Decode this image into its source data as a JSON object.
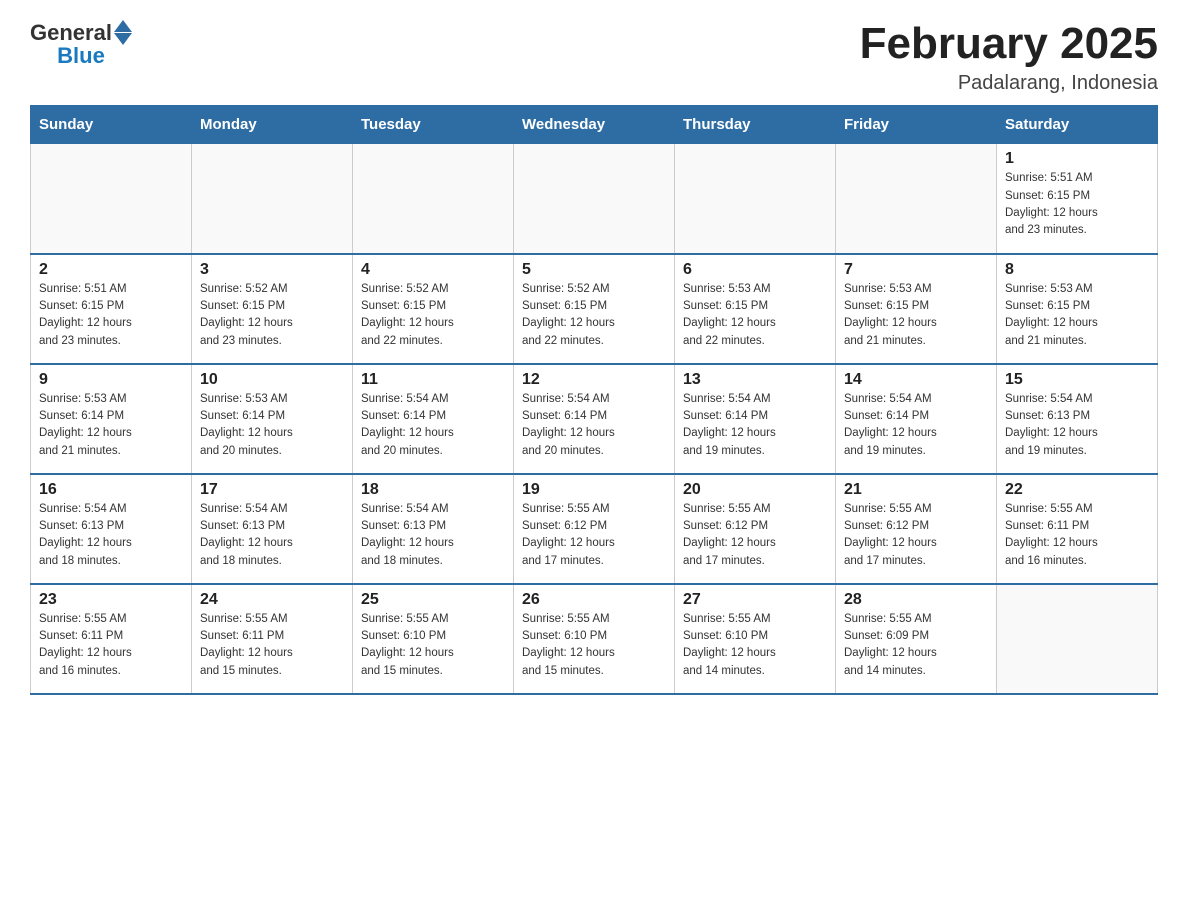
{
  "header": {
    "logo_general": "General",
    "logo_blue": "Blue",
    "title": "February 2025",
    "subtitle": "Padalarang, Indonesia"
  },
  "days_of_week": [
    "Sunday",
    "Monday",
    "Tuesday",
    "Wednesday",
    "Thursday",
    "Friday",
    "Saturday"
  ],
  "weeks": [
    [
      {
        "day": "",
        "info": ""
      },
      {
        "day": "",
        "info": ""
      },
      {
        "day": "",
        "info": ""
      },
      {
        "day": "",
        "info": ""
      },
      {
        "day": "",
        "info": ""
      },
      {
        "day": "",
        "info": ""
      },
      {
        "day": "1",
        "info": "Sunrise: 5:51 AM\nSunset: 6:15 PM\nDaylight: 12 hours\nand 23 minutes."
      }
    ],
    [
      {
        "day": "2",
        "info": "Sunrise: 5:51 AM\nSunset: 6:15 PM\nDaylight: 12 hours\nand 23 minutes."
      },
      {
        "day": "3",
        "info": "Sunrise: 5:52 AM\nSunset: 6:15 PM\nDaylight: 12 hours\nand 23 minutes."
      },
      {
        "day": "4",
        "info": "Sunrise: 5:52 AM\nSunset: 6:15 PM\nDaylight: 12 hours\nand 22 minutes."
      },
      {
        "day": "5",
        "info": "Sunrise: 5:52 AM\nSunset: 6:15 PM\nDaylight: 12 hours\nand 22 minutes."
      },
      {
        "day": "6",
        "info": "Sunrise: 5:53 AM\nSunset: 6:15 PM\nDaylight: 12 hours\nand 22 minutes."
      },
      {
        "day": "7",
        "info": "Sunrise: 5:53 AM\nSunset: 6:15 PM\nDaylight: 12 hours\nand 21 minutes."
      },
      {
        "day": "8",
        "info": "Sunrise: 5:53 AM\nSunset: 6:15 PM\nDaylight: 12 hours\nand 21 minutes."
      }
    ],
    [
      {
        "day": "9",
        "info": "Sunrise: 5:53 AM\nSunset: 6:14 PM\nDaylight: 12 hours\nand 21 minutes."
      },
      {
        "day": "10",
        "info": "Sunrise: 5:53 AM\nSunset: 6:14 PM\nDaylight: 12 hours\nand 20 minutes."
      },
      {
        "day": "11",
        "info": "Sunrise: 5:54 AM\nSunset: 6:14 PM\nDaylight: 12 hours\nand 20 minutes."
      },
      {
        "day": "12",
        "info": "Sunrise: 5:54 AM\nSunset: 6:14 PM\nDaylight: 12 hours\nand 20 minutes."
      },
      {
        "day": "13",
        "info": "Sunrise: 5:54 AM\nSunset: 6:14 PM\nDaylight: 12 hours\nand 19 minutes."
      },
      {
        "day": "14",
        "info": "Sunrise: 5:54 AM\nSunset: 6:14 PM\nDaylight: 12 hours\nand 19 minutes."
      },
      {
        "day": "15",
        "info": "Sunrise: 5:54 AM\nSunset: 6:13 PM\nDaylight: 12 hours\nand 19 minutes."
      }
    ],
    [
      {
        "day": "16",
        "info": "Sunrise: 5:54 AM\nSunset: 6:13 PM\nDaylight: 12 hours\nand 18 minutes."
      },
      {
        "day": "17",
        "info": "Sunrise: 5:54 AM\nSunset: 6:13 PM\nDaylight: 12 hours\nand 18 minutes."
      },
      {
        "day": "18",
        "info": "Sunrise: 5:54 AM\nSunset: 6:13 PM\nDaylight: 12 hours\nand 18 minutes."
      },
      {
        "day": "19",
        "info": "Sunrise: 5:55 AM\nSunset: 6:12 PM\nDaylight: 12 hours\nand 17 minutes."
      },
      {
        "day": "20",
        "info": "Sunrise: 5:55 AM\nSunset: 6:12 PM\nDaylight: 12 hours\nand 17 minutes."
      },
      {
        "day": "21",
        "info": "Sunrise: 5:55 AM\nSunset: 6:12 PM\nDaylight: 12 hours\nand 17 minutes."
      },
      {
        "day": "22",
        "info": "Sunrise: 5:55 AM\nSunset: 6:11 PM\nDaylight: 12 hours\nand 16 minutes."
      }
    ],
    [
      {
        "day": "23",
        "info": "Sunrise: 5:55 AM\nSunset: 6:11 PM\nDaylight: 12 hours\nand 16 minutes."
      },
      {
        "day": "24",
        "info": "Sunrise: 5:55 AM\nSunset: 6:11 PM\nDaylight: 12 hours\nand 15 minutes."
      },
      {
        "day": "25",
        "info": "Sunrise: 5:55 AM\nSunset: 6:10 PM\nDaylight: 12 hours\nand 15 minutes."
      },
      {
        "day": "26",
        "info": "Sunrise: 5:55 AM\nSunset: 6:10 PM\nDaylight: 12 hours\nand 15 minutes."
      },
      {
        "day": "27",
        "info": "Sunrise: 5:55 AM\nSunset: 6:10 PM\nDaylight: 12 hours\nand 14 minutes."
      },
      {
        "day": "28",
        "info": "Sunrise: 5:55 AM\nSunset: 6:09 PM\nDaylight: 12 hours\nand 14 minutes."
      },
      {
        "day": "",
        "info": ""
      }
    ]
  ]
}
